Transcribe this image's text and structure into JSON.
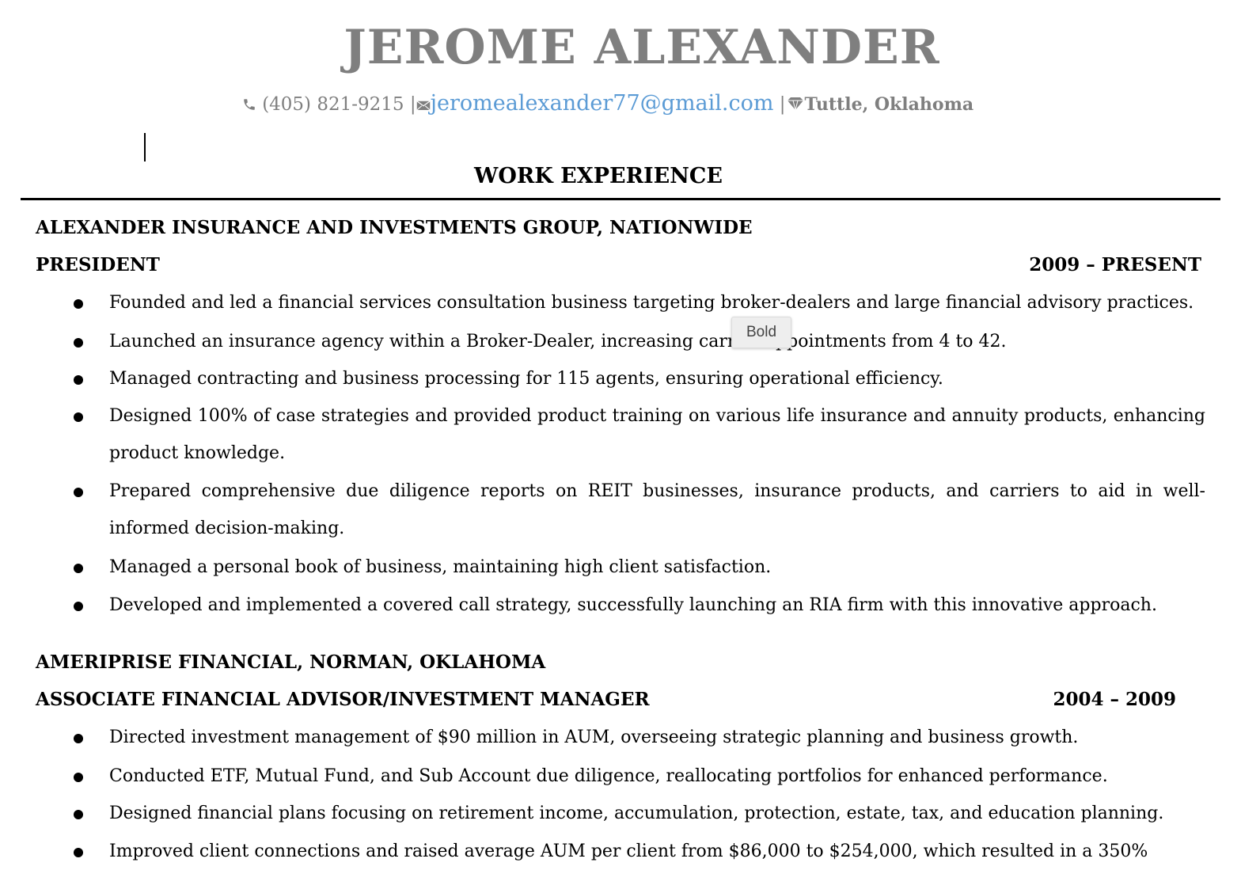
{
  "header": {
    "name": "JEROME ALEXANDER",
    "phone": "(405) 821-9215",
    "separator": "|",
    "email": "jeromealexander77@gmail.com",
    "location": "Tuttle, Oklahoma"
  },
  "section": {
    "title": "WORK EXPERIENCE"
  },
  "jobs": [
    {
      "company": "ALEXANDER INSURANCE AND INVESTMENTS GROUP, NATIONWIDE",
      "title": "PRESIDENT",
      "dates": "2009 – PRESENT",
      "bullets": [
        "Founded and led a financial services consultation business targeting broker-dealers and large financial advisory practices.",
        "Launched an insurance agency within a Broker-Dealer, increasing carrier appointments from 4 to 42.",
        "Managed contracting and business processing for 115 agents, ensuring operational efficiency.",
        "Designed 100% of case strategies and provided product training on various life insurance and annuity products, enhancing product knowledge.",
        "Prepared comprehensive due diligence reports on REIT businesses, insurance products, and carriers to aid in well-informed decision-making.",
        "Managed a personal book of business, maintaining high client satisfaction.",
        "Developed and implemented a covered call strategy, successfully launching an RIA firm with this innovative approach."
      ]
    },
    {
      "company": "AMERIPRISE FINANCIAL, NORMAN, OKLAHOMA",
      "title": "ASSOCIATE FINANCIAL ADVISOR/INVESTMENT MANAGER",
      "dates": "2004 – 2009",
      "bullets": [
        "Directed investment management of $90 million in AUM, overseeing strategic planning and business growth.",
        "Conducted ETF, Mutual Fund, and Sub Account due diligence, reallocating portfolios for enhanced performance.",
        "Designed financial plans focusing on retirement income, accumulation, protection, estate, tax, and education planning.",
        "Improved client connections and raised average AUM per client from $86,000 to $254,000, which resulted in a 350%"
      ]
    }
  ],
  "tooltip": {
    "label": "Bold"
  }
}
